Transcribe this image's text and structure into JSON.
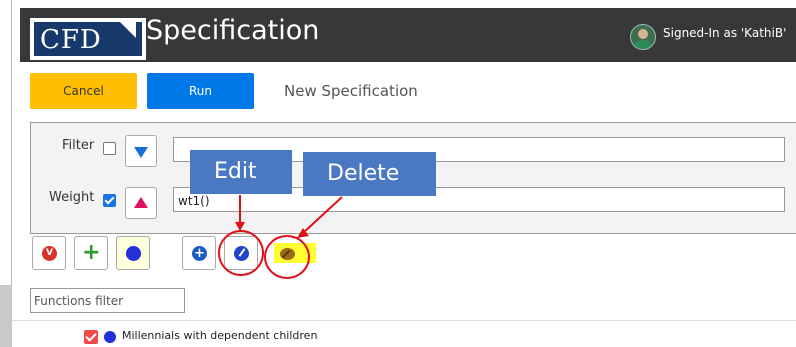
{
  "header": {
    "logo_text": "CFD",
    "title": "Specification",
    "signed_in": "Signed-In as 'KathiB'"
  },
  "toolbar": {
    "cancel_label": "Cancel",
    "run_label": "Run",
    "spec_name": "New Specification"
  },
  "filter": {
    "label": "Filter",
    "checked": false,
    "value": ""
  },
  "weight": {
    "label": "Weight",
    "checked": true,
    "value": "wt1()"
  },
  "annotations": {
    "edit": "Edit",
    "delete": "Delete"
  },
  "functions_filter": {
    "placeholder": "Functions filter"
  },
  "list": [
    {
      "label": "Millennials with dependent children",
      "checked": true
    }
  ],
  "colors": {
    "header_bg": "#383838",
    "cancel": "#ffbf00",
    "run": "#0078e8",
    "callout": "#4a78c2",
    "annotation_ring": "#e0101a"
  },
  "icons": [
    "filter-toggle-icon",
    "weight-toggle-icon",
    "delete-red-icon",
    "add-green-icon",
    "blue-dot-icon",
    "add-blue-icon",
    "edit-icon",
    "delete-icon"
  ]
}
